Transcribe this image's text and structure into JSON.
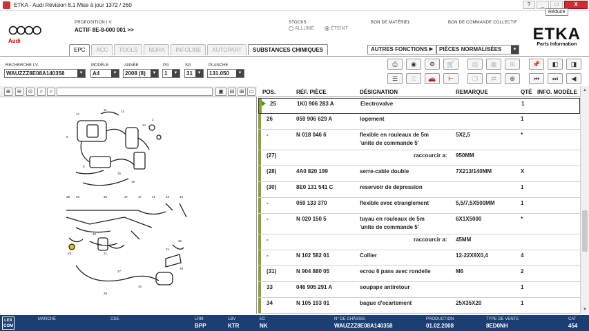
{
  "window": {
    "title": "ETKA - Audi Révision 8.1 Mise à jour 1372 / 260",
    "tooltip": "Réduire",
    "buttons": [
      "?",
      "_",
      "□",
      "X"
    ]
  },
  "header": {
    "brand_word": "Audi",
    "proposition_label": "PROPOSITION I.V.",
    "proposition_value": "ACTIF  8E-8-000 001 >>",
    "stocks_label": "STOCKS",
    "stock_on": "ALLUMÉ",
    "stock_off": "ÉTEINT",
    "bon_materiel": "BON DE MATÉRIEL",
    "bon_commande": "BON DE COMMANDE COLLECTIF",
    "logo_big": "ETKA",
    "logo_sub": "Parts Information"
  },
  "tabs": [
    {
      "label": "EPC",
      "state": "active"
    },
    {
      "label": "ACC",
      "state": "dim"
    },
    {
      "label": "TOOLS",
      "state": "dim"
    },
    {
      "label": "NORA",
      "state": "dim"
    },
    {
      "label": "INFOLINE",
      "state": "dim"
    },
    {
      "label": "AUTOPART",
      "state": "dim"
    },
    {
      "label": "SUBSTANCES CHIMIQUES",
      "state": "strong"
    }
  ],
  "autres_fonctions": "AUTRES FONCTIONS",
  "pieces_select": "PIÈCES NORMALISÉES",
  "search": {
    "recherche_label": "RECHERCHE I.V.",
    "recherche_value": "WAUZZZ8E08A140358",
    "modele_label": "MODÈLE",
    "modele_value": "A4",
    "annee_label": "ANNÉE",
    "annee_value": "2008 (8)",
    "pg_label": "PG",
    "pg_value": "1",
    "sg_label": "SG",
    "sg_value": "31",
    "planche_label": "PLANCHE",
    "planche_value": "131.050"
  },
  "table": {
    "headers": {
      "pos": "POS.",
      "ref": "RÉF. PIÈCE",
      "des": "DÉSIGNATION",
      "rem": "REMARQUE",
      "qte": "QTÉ",
      "info": "INFO. MODÈLE"
    },
    "rows": [
      {
        "pos": "25",
        "ref": "1K0  906  283  A",
        "des": "Electrovalve",
        "des2": "",
        "rem": "",
        "qte": "1",
        "selected": true
      },
      {
        "pos": "26",
        "ref": "059  906  629  A",
        "des": "logement",
        "des2": "",
        "rem": "",
        "qte": "1"
      },
      {
        "pos": "-",
        "ref": "N     018  046  6",
        "des": "flexible en rouleaux de 5m",
        "des2": "'unite de commande 5'",
        "rem": "5X2,5",
        "qte": "*"
      },
      {
        "pos": "(27)",
        "ref": "",
        "des": "raccourcir a:",
        "des2": "",
        "rem": "950MM",
        "qte": "",
        "indent": true
      },
      {
        "pos": "(28)",
        "ref": "4A0  820  199",
        "des": "serre-cable double",
        "des2": "",
        "rem": "7X213/140MM",
        "qte": "X"
      },
      {
        "pos": "(30)",
        "ref": "8E0  131  541  C",
        "des": "reservoir de depression",
        "des2": "",
        "rem": "",
        "qte": "1"
      },
      {
        "pos": "-",
        "ref": "059  133  370",
        "des": "flexible avec etranglement",
        "des2": "",
        "rem": "5,5/7,5X500MM",
        "qte": "1"
      },
      {
        "pos": "-",
        "ref": "N     020  150  5",
        "des": "tuyau en rouleaux de 5m",
        "des2": "'unite de commande 5'",
        "rem": "6X1X5000",
        "qte": "*"
      },
      {
        "pos": "-",
        "ref": "",
        "des": "raccourcir a:",
        "des2": "",
        "rem": "45MM",
        "qte": "",
        "indent": true
      },
      {
        "pos": "-",
        "ref": "N     102  582  01",
        "des": "Collier",
        "des2": "",
        "rem": "12-22X9X0,4",
        "qte": "4"
      },
      {
        "pos": "(31)",
        "ref": "N     904  880  05",
        "des": "ecrou 6 pans avec rondelle",
        "des2": "",
        "rem": "M6",
        "qte": "2"
      },
      {
        "pos": "33",
        "ref": "046  905  291  A",
        "des": "soupape antiretour",
        "des2": "",
        "rem": "",
        "qte": "1"
      },
      {
        "pos": "34",
        "ref": "N     105  193  01",
        "des": "bague d'ecartement",
        "des2": "",
        "rem": "25X35X20",
        "qte": "1"
      }
    ]
  },
  "footer": {
    "logo": "LEX COM",
    "marche_label": "MARCHÉ",
    "cde_label": "CDE",
    "lrm_label": "LRM",
    "lrm_value": "BPP",
    "lbv_label": "LBV",
    "lbv_value": "KTR",
    "ec_label": "EC",
    "ec_value": "NK",
    "chassis_label": "N° DE CHÂSSIS",
    "chassis_value": "WAUZZZ8E08A140358",
    "production_label": "PRODUCTION",
    "production_value": "01.02.2008",
    "vente_label": "TYPE DE VENTE",
    "vente_value": "8ED0NH",
    "cat_label": "CAT",
    "cat_value": "454"
  },
  "colors": {
    "footer_bg": "#1c3f73",
    "row_bar": "#8aa033",
    "audi_red": "#c00000",
    "close_red": "#c9302c"
  }
}
